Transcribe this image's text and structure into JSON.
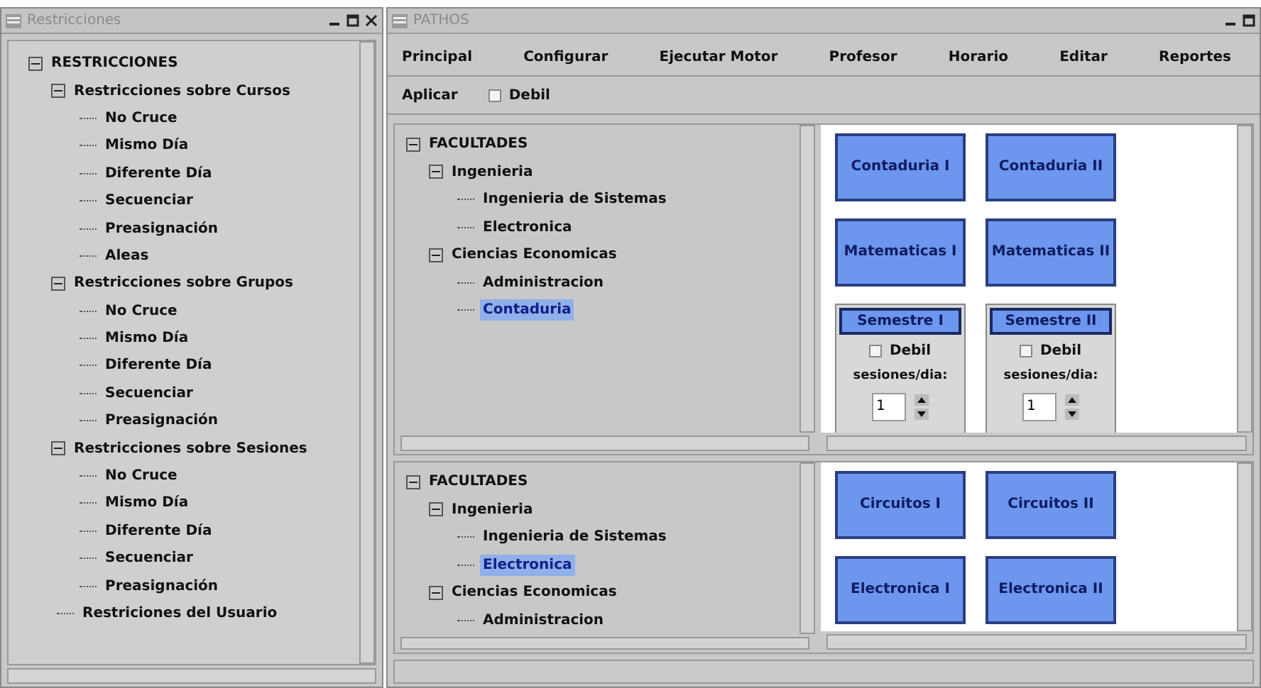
{
  "restricciones_window": {
    "title": "Restricciones",
    "tree": [
      {
        "label": "RESTRICCIONES",
        "expanded": true,
        "children": [
          {
            "label": "Restricciones sobre Cursos",
            "expanded": true,
            "children": [
              {
                "label": "No Cruce"
              },
              {
                "label": "Mismo Día"
              },
              {
                "label": "Diferente Día"
              },
              {
                "label": "Secuenciar"
              },
              {
                "label": "Preasignación"
              },
              {
                "label": "Aleas"
              }
            ]
          },
          {
            "label": "Restricciones sobre Grupos",
            "expanded": true,
            "children": [
              {
                "label": "No Cruce"
              },
              {
                "label": "Mismo Día"
              },
              {
                "label": "Diferente Día"
              },
              {
                "label": "Secuenciar"
              },
              {
                "label": "Preasignación"
              }
            ]
          },
          {
            "label": "Restricciones sobre Sesiones",
            "expanded": true,
            "children": [
              {
                "label": "No Cruce"
              },
              {
                "label": "Mismo Día"
              },
              {
                "label": "Diferente Día"
              },
              {
                "label": "Secuenciar"
              },
              {
                "label": "Preasignación"
              }
            ]
          },
          {
            "label": "Restriciones del Usuario"
          }
        ]
      }
    ]
  },
  "main_window": {
    "title": "PATHOS",
    "menu": [
      "Principal",
      "Configurar",
      "Ejecutar Motor",
      "Profesor",
      "Horario",
      "Editar",
      "Reportes"
    ],
    "toolbar": {
      "apply": "Aplicar",
      "debil": {
        "label": "Debil",
        "checked": false
      }
    },
    "panes": [
      {
        "tree": [
          {
            "label": "FACULTADES",
            "expanded": true,
            "selected": false,
            "children": [
              {
                "label": "Ingenieria",
                "expanded": true,
                "selected": false,
                "children": [
                  {
                    "label": "Ingenieria de Sistemas",
                    "selected": false
                  },
                  {
                    "label": "Electronica",
                    "selected": false
                  }
                ]
              },
              {
                "label": "Ciencias Economicas",
                "expanded": true,
                "selected": false,
                "children": [
                  {
                    "label": "Administracion",
                    "selected": false
                  },
                  {
                    "label": "Contaduria",
                    "selected": true
                  }
                ]
              }
            ]
          }
        ],
        "courses": [
          "Contaduria I",
          "Contaduria II",
          "Matematicas I",
          "Matematicas II"
        ],
        "semesters": [
          {
            "title": "Semestre I",
            "debil": {
              "label": "Debil",
              "checked": false
            },
            "sessions_label": "sesiones/dia:",
            "sessions": "1"
          },
          {
            "title": "Semestre II",
            "debil": {
              "label": "Debil",
              "checked": false
            },
            "sessions_label": "sesiones/dia:",
            "sessions": "1"
          }
        ]
      },
      {
        "tree": [
          {
            "label": "FACULTADES",
            "expanded": true,
            "selected": false,
            "children": [
              {
                "label": "Ingenieria",
                "expanded": true,
                "selected": false,
                "children": [
                  {
                    "label": "Ingenieria de Sistemas",
                    "selected": false
                  },
                  {
                    "label": "Electronica",
                    "selected": true
                  }
                ]
              },
              {
                "label": "Ciencias Economicas",
                "expanded": true,
                "selected": false,
                "children": [
                  {
                    "label": "Administracion",
                    "selected": false
                  }
                ]
              }
            ]
          }
        ],
        "courses": [
          "Circuitos I",
          "Circuitos II",
          "Electronica I",
          "Electronica II"
        ]
      }
    ]
  }
}
